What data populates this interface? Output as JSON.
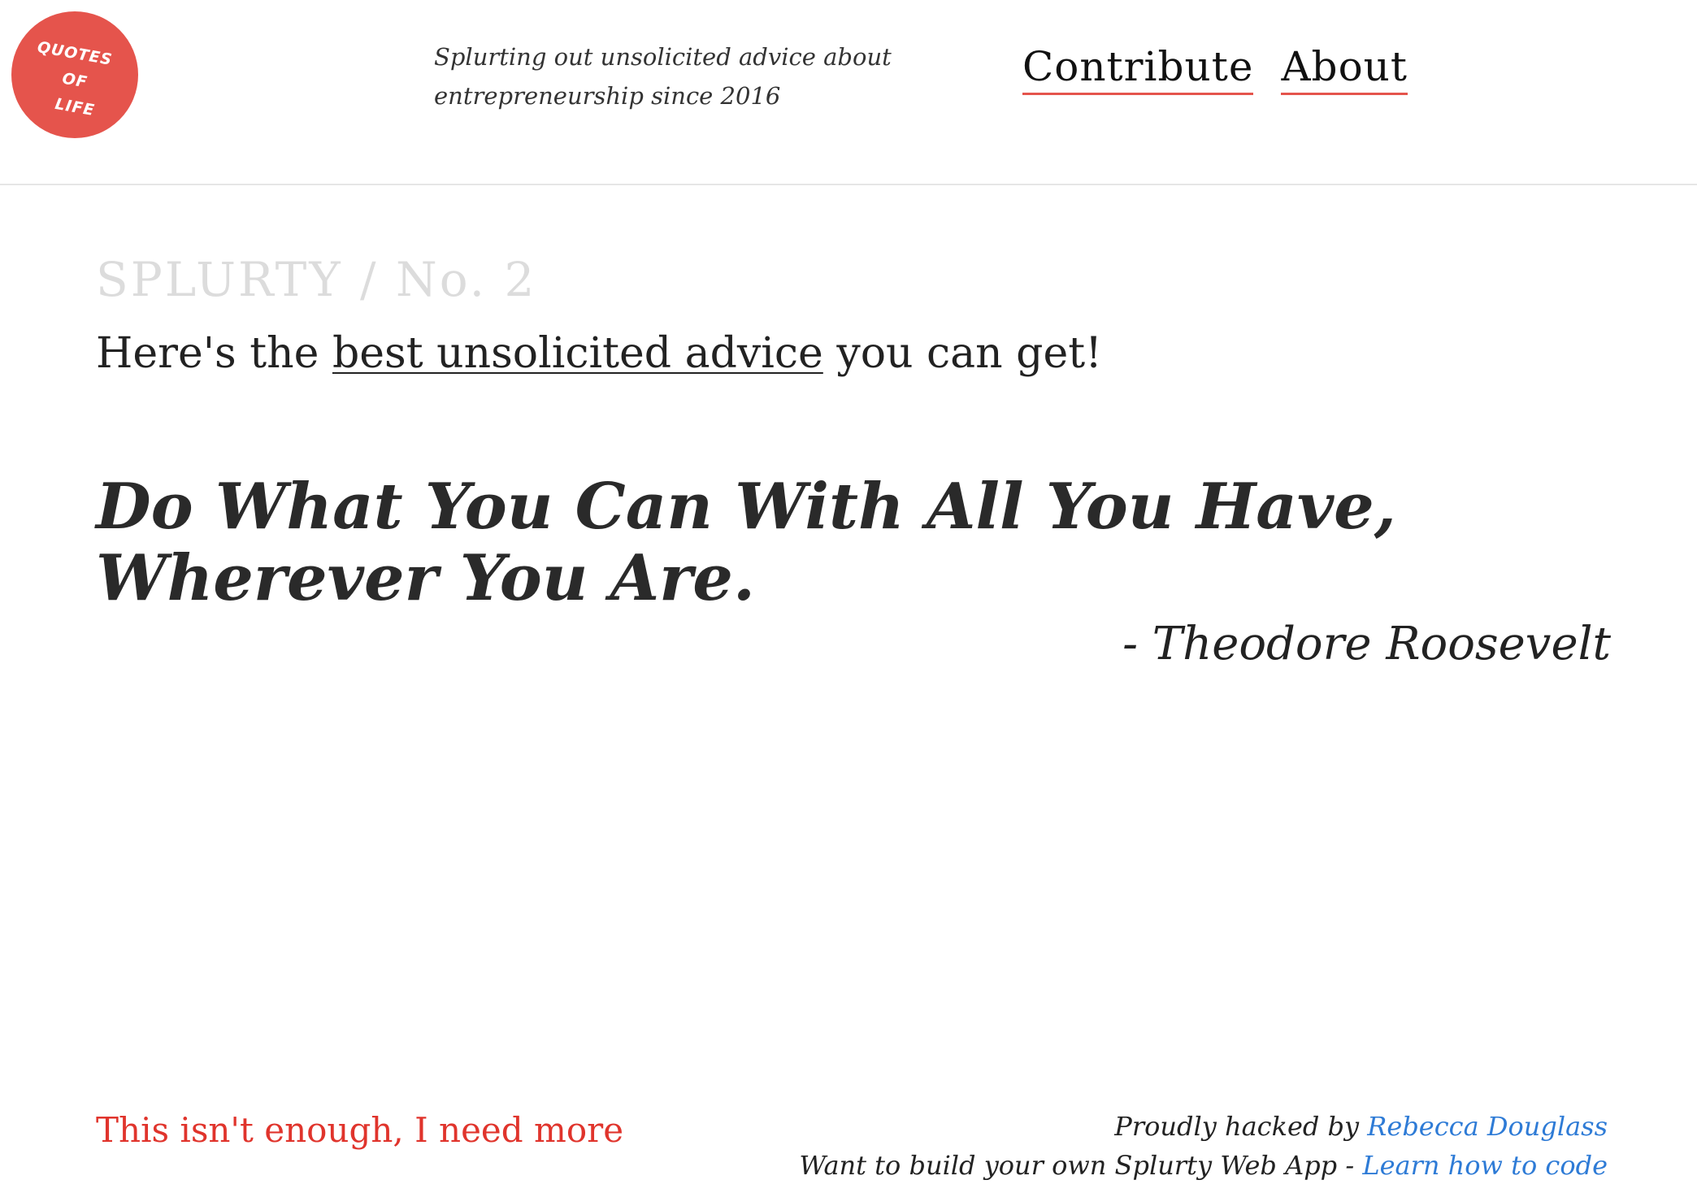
{
  "header": {
    "logo": {
      "line1": "QUOTES",
      "line2": "OF",
      "line3": "LIFE",
      "color": "#e5544c"
    },
    "tagline": "Splurting out unsolicited advice about entrepreneurship since 2016",
    "nav": {
      "contribute": "Contribute",
      "about": "About"
    }
  },
  "main": {
    "kicker": "SPLURTY / No. 2",
    "intro_before": "Here's the ",
    "intro_link": "best unsolicited advice",
    "intro_after": " you can get!",
    "quote": "Do What You Can With All You Have, Wherever You Are.",
    "author": "- Theodore Roosevelt"
  },
  "footer": {
    "more_link": "This isn't enough, I need more",
    "credit_prefix": "Proudly hacked by ",
    "credit_name": "Rebecca Douglass",
    "build_prefix": "Want to build your own Splurty Web App - ",
    "build_link": "Learn how to code"
  },
  "colors": {
    "accent": "#e5544c",
    "link_red": "#e0342c",
    "link_blue": "#2e7bd6",
    "muted": "#dcdcdc"
  }
}
